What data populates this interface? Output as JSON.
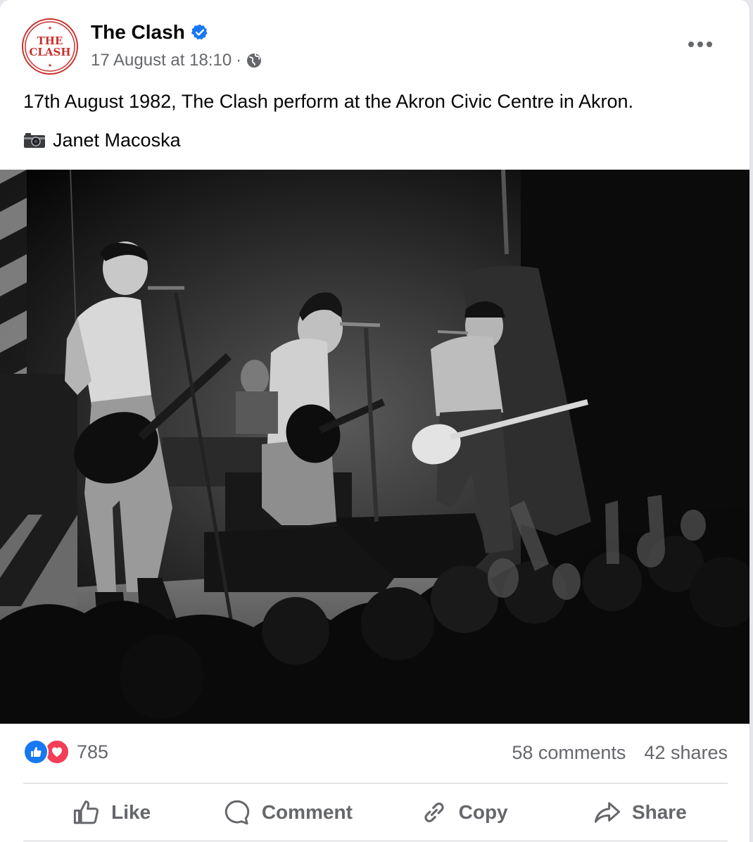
{
  "post": {
    "page_name": "The Clash",
    "avatar_text_line1": "THE",
    "avatar_text_line2": "CLASH",
    "timestamp": "17 August at 18:10",
    "separator": "·",
    "caption": "17th August 1982, The Clash perform at the Akron Civic Centre in Akron.",
    "photo_credit": "Janet Macoska"
  },
  "stats": {
    "reaction_count": "785",
    "comments": "58 comments",
    "shares": "42 shares"
  },
  "actions": [
    {
      "label": "Like"
    },
    {
      "label": "Comment"
    },
    {
      "label": "Copy"
    },
    {
      "label": "Share"
    }
  ],
  "colors": {
    "verified_blue": "#1877f2",
    "secondary_text": "#65676b",
    "love_red": "#f33e58",
    "logo_red": "#c9302c"
  }
}
